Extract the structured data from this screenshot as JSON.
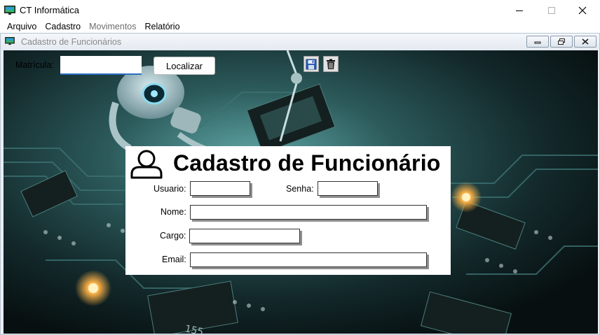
{
  "window": {
    "title": "CT Informática",
    "minimize_icon": "minimize-icon",
    "maximize_icon": "maximize-icon",
    "close_icon": "close-icon"
  },
  "menu": {
    "items": [
      {
        "label": "Arquivo",
        "enabled": true
      },
      {
        "label": "Cadastro",
        "enabled": true
      },
      {
        "label": "Movimentos",
        "enabled": false
      },
      {
        "label": "Relatório",
        "enabled": true
      }
    ]
  },
  "child_window": {
    "title": "Cadastro de Funcionários",
    "title_color": "#8a8a8a"
  },
  "toolbar": {
    "matricula_label": "Matrícula:",
    "matricula_value": "",
    "localizar_label": "Localizar",
    "save_icon": "floppy-disk-icon",
    "delete_icon": "trash-icon"
  },
  "form": {
    "title": "Cadastro de Funcionário",
    "icon": "user-icon",
    "fields": {
      "usuario": {
        "label": "Usuario:",
        "value": ""
      },
      "senha": {
        "label": "Senha:",
        "value": ""
      },
      "nome": {
        "label": "Nome:",
        "value": ""
      },
      "cargo": {
        "label": "Cargo:",
        "value": ""
      },
      "email": {
        "label": "Email:",
        "value": ""
      }
    }
  },
  "colors": {
    "accent_input_underline": "#2a6fc2",
    "save_icon_blue": "#2c5fb8",
    "background_dark": "#0d1819",
    "glow_orange": "#ffb347"
  }
}
